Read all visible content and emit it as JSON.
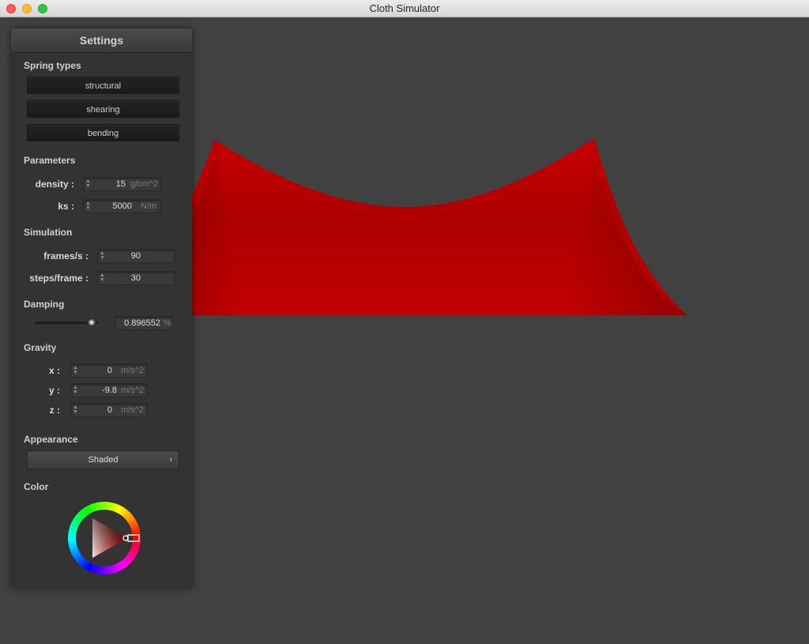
{
  "window": {
    "title": "Cloth Simulator"
  },
  "cloth": {
    "color": "#b00000"
  },
  "settings": {
    "title": "Settings",
    "spring_types": {
      "label": "Spring types",
      "buttons": [
        "structural",
        "shearing",
        "bending"
      ]
    },
    "parameters": {
      "label": "Parameters",
      "density": {
        "label": "density :",
        "value": "15",
        "unit": "g/cm^2"
      },
      "ks": {
        "label": "ks :",
        "value": "5000",
        "unit": "N/m"
      }
    },
    "simulation": {
      "label": "Simulation",
      "fps": {
        "label": "frames/s :",
        "value": "90"
      },
      "steps": {
        "label": "steps/frame :",
        "value": "30"
      }
    },
    "damping": {
      "label": "Damping",
      "slider_fraction": 0.9,
      "value": "0.896552",
      "unit": "%"
    },
    "gravity": {
      "label": "Gravity",
      "x": {
        "label": "x :",
        "value": "0",
        "unit": "m/s^2"
      },
      "y": {
        "label": "y :",
        "value": "-9.8",
        "unit": "m/s^2"
      },
      "z": {
        "label": "z :",
        "value": "0",
        "unit": "m/s^2"
      }
    },
    "appearance": {
      "label": "Appearance",
      "selected": "Shaded"
    },
    "color": {
      "label": "Color",
      "selected": "#ff0000"
    }
  }
}
